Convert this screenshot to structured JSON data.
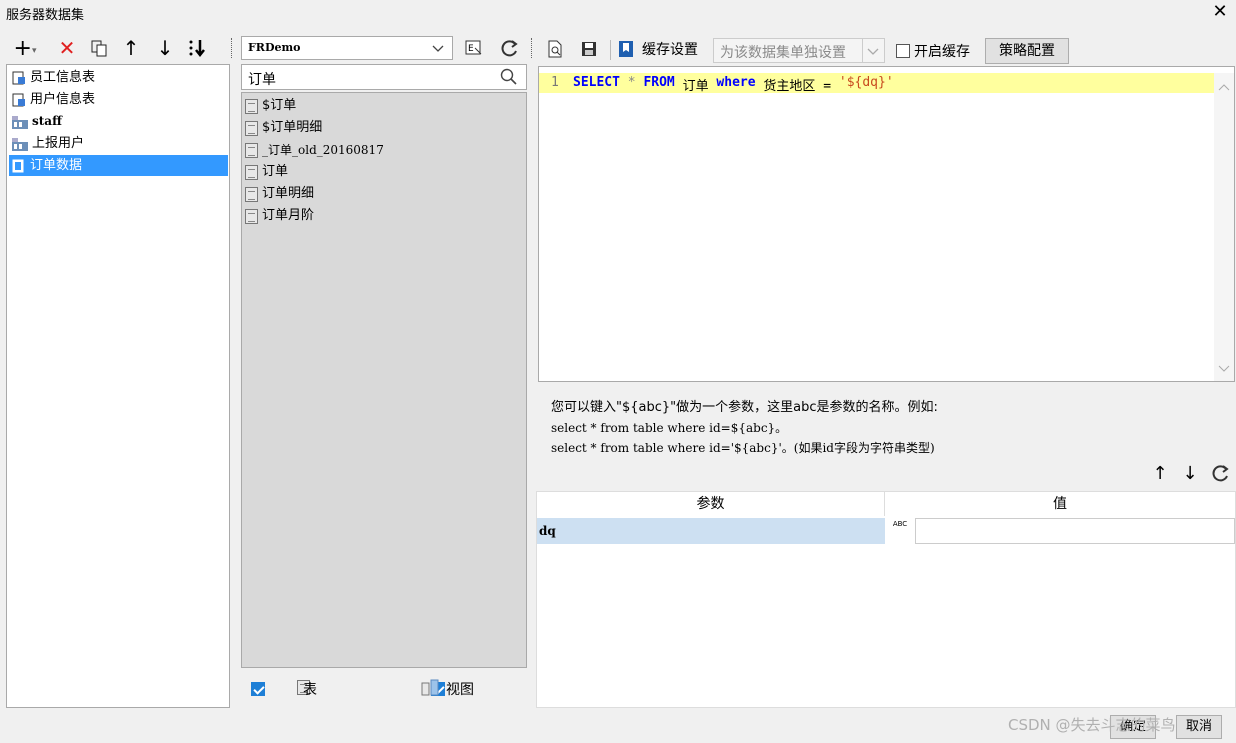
{
  "window": {
    "title": "服务器数据集",
    "close_glyph": "✕"
  },
  "left": {
    "toolbar": {
      "add": "+",
      "add_arrow": "▾",
      "delete": "✕",
      "up": "↑",
      "down": "↓"
    },
    "items": [
      {
        "label": "员工信息表"
      },
      {
        "label": "用户信息表"
      },
      {
        "label": "staff"
      },
      {
        "label": "上报用户"
      },
      {
        "label": "订单数据"
      }
    ]
  },
  "middle": {
    "connection": "FRDemo",
    "search_value": "订单",
    "tables": [
      "$订单",
      "$订单明细",
      "_订单_old_20160817",
      "订单",
      "订单明细",
      "订单月阶"
    ],
    "footer": {
      "table_label": "表",
      "view_label": "视图"
    }
  },
  "right": {
    "toolbar": {
      "cache_settings": "缓存设置",
      "cache_mode": "为该数据集单独设置",
      "enable_cache": "开启缓存",
      "strategy": "策略配置"
    },
    "sql": {
      "line_no": "1",
      "kw1": "SELECT",
      "star": " * ",
      "kw2": "FROM",
      "table": " 订单 ",
      "kw3": "where",
      "cond": " 货主地区 = ",
      "str": "'${dq}'"
    },
    "hint": {
      "line1": "您可以键入\"${abc}\"做为一个参数，这里abc是参数的名称。例如:",
      "line2": "select * from table where id=${abc}。",
      "line3": "select * from table where id='${abc}'。(如果id字段为字符串类型)"
    },
    "params": {
      "col_param": "参数",
      "col_value": "值",
      "rows": [
        {
          "name": "dq",
          "type_icon": "ABC",
          "value": ""
        }
      ]
    }
  },
  "footer": {
    "ok": "确定",
    "cancel": "取消",
    "watermark": "CSDN @失去斗志的菜鸟"
  }
}
